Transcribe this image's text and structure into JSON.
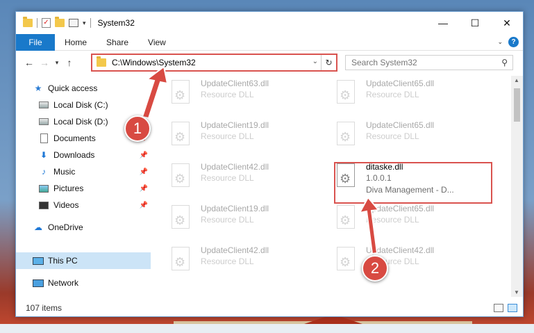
{
  "window": {
    "title": "System32",
    "controls": {
      "minimize": "—",
      "maximize": "☐",
      "close": "✕"
    }
  },
  "ribbon": {
    "tabs": [
      {
        "label": "File",
        "active": true
      },
      {
        "label": "Home"
      },
      {
        "label": "Share"
      },
      {
        "label": "View"
      }
    ]
  },
  "nav": {
    "path": "C:\\Windows\\System32",
    "search_placeholder": "Search System32"
  },
  "sidebar": {
    "items": [
      {
        "label": "Quick access",
        "icon": "star-icon",
        "pinned": false
      },
      {
        "label": "Local Disk (C:)",
        "icon": "drive-icon",
        "pinned": false
      },
      {
        "label": "Local Disk (D:)",
        "icon": "drive-icon",
        "pinned": false
      },
      {
        "label": "Documents",
        "icon": "documents-icon",
        "pinned": true
      },
      {
        "label": "Downloads",
        "icon": "download-icon",
        "pinned": true
      },
      {
        "label": "Music",
        "icon": "music-icon",
        "pinned": true
      },
      {
        "label": "Pictures",
        "icon": "pictures-icon",
        "pinned": true
      },
      {
        "label": "Videos",
        "icon": "videos-icon",
        "pinned": true
      },
      {
        "label": "OneDrive",
        "icon": "onedrive-icon",
        "pinned": false
      },
      {
        "label": "This PC",
        "icon": "pc-icon",
        "pinned": false,
        "selected": true
      },
      {
        "label": "Network",
        "icon": "network-icon",
        "pinned": false
      }
    ]
  },
  "files": [
    {
      "name": "UpdateClient63.dll",
      "sub1": "Resource DLL",
      "sub2": ""
    },
    {
      "name": "UpdateClient65.dll",
      "sub1": "Resource DLL",
      "sub2": ""
    },
    {
      "name": "UpdateClient19.dll",
      "sub1": "Resource DLL",
      "sub2": ""
    },
    {
      "name": "UpdateClient65.dll",
      "sub1": "Resource DLL",
      "sub2": ""
    },
    {
      "name": "UpdateClient42.dll",
      "sub1": "Resource DLL",
      "sub2": ""
    },
    {
      "name": "ditaske.dll",
      "sub1": "1.0.0.1",
      "sub2": "Diva Management - D...",
      "selected": true
    },
    {
      "name": "UpdateClient19.dll",
      "sub1": "Resource DLL",
      "sub2": ""
    },
    {
      "name": "UpdateClient65.dll",
      "sub1": "Resource DLL",
      "sub2": ""
    },
    {
      "name": "UpdateClient42.dll",
      "sub1": "Resource DLL",
      "sub2": ""
    },
    {
      "name": "UpdateClient42.dll",
      "sub1": "Resource DLL",
      "sub2": ""
    }
  ],
  "status": {
    "count": "107 items"
  },
  "callouts": [
    "1",
    "2"
  ],
  "colors": {
    "accent": "#1979ca",
    "highlight": "#d9534f",
    "selection": "#cce4f7"
  }
}
